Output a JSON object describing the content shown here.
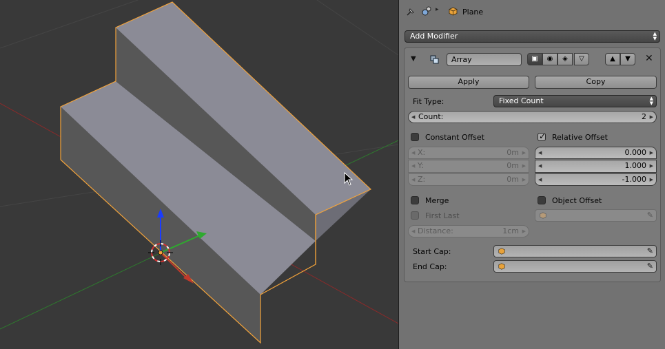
{
  "header": {
    "object_name": "Plane",
    "pin_icon": "pin-icon",
    "scene_icon": "scene-icon"
  },
  "add_modifier": {
    "label": "Add Modifier"
  },
  "modifier": {
    "name": "Array",
    "apply_label": "Apply",
    "copy_label": "Copy",
    "fit_type": {
      "label": "Fit Type:",
      "value": "Fixed Count"
    },
    "count": {
      "label": "Count:",
      "value": "2"
    },
    "constant_offset": {
      "label": "Constant Offset",
      "checked": false,
      "x": {
        "label": "X:",
        "value": "0m"
      },
      "y": {
        "label": "Y:",
        "value": "0m"
      },
      "z": {
        "label": "Z:",
        "value": "0m"
      }
    },
    "relative_offset": {
      "label": "Relative Offset",
      "checked": true,
      "x": "0.000",
      "y": "1.000",
      "z": "-1.000"
    },
    "merge": {
      "label": "Merge",
      "checked": false
    },
    "first_last": {
      "label": "First Last",
      "checked": false
    },
    "distance": {
      "label": "Distance:",
      "value": "1cm"
    },
    "object_offset": {
      "label": "Object Offset",
      "checked": false
    },
    "start_cap": {
      "label": "Start Cap:"
    },
    "end_cap": {
      "label": "End Cap:"
    }
  },
  "colors": {
    "viewport_bg": "#393939",
    "panel_bg": "#727272",
    "selection_outline": "#f3a33a",
    "x_axis": "#c0392b",
    "y_axis": "#2eaa2e",
    "z_axis": "#1a3cff"
  }
}
